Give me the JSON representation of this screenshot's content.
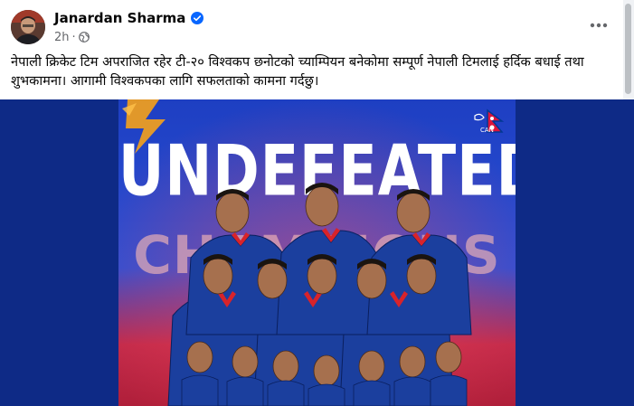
{
  "post": {
    "author": "Janardan Sharma",
    "time": "2h",
    "separator": "·",
    "text": "नेपाली क्रिकेट टिम अपराजित रहेर टी-२० विश्वकप छनोटको च्याम्पियन बनेकोमा सम्पूर्ण नेपाली टिमलाई हर्दिक बधाई तथा शुभकामना। आगामी विश्वकपका लागि सफलताको कामना गर्दछु।"
  },
  "image": {
    "headline_line1": "UNDEFEATED",
    "headline_line2": "CHAMPIONS",
    "logo_text": "CAN"
  },
  "icons": {
    "verified": "verified-badge-icon",
    "audience": "globe-icon",
    "more": "more-options-icon"
  },
  "colors": {
    "verified_blue": "#0866ff",
    "poster_bg": "#0e2a86",
    "jersey": "#1b3f9e",
    "jersey_red": "#d8232a"
  }
}
